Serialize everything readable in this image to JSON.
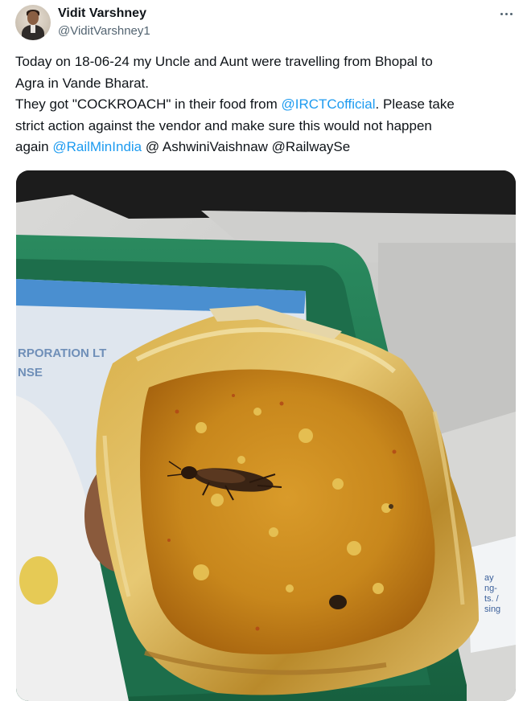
{
  "author": {
    "display_name": "Vidit Varshney",
    "handle": "@ViditVarshney1",
    "avatar_icon": "profile-photo"
  },
  "more_icon": "more-dots-icon",
  "tweet": {
    "line1": "Today on 18-06-24 my Uncle and Aunt were travelling from Bhopal to",
    "line2": "Agra in Vande Bharat.",
    "line3_pre": "They got \"COCKROACH\" in their food from ",
    "mention_irctc": "@IRCTCofficial",
    "line3_post": ". Please take",
    "line4": "strict action against the vendor and make sure this would not happen",
    "line5_pre": "again ",
    "mention_railmin": "@RailMinIndia",
    "line5_post": " @ AshwiniVaishnaw @RailwaySe"
  },
  "media": {
    "tray_text_line1": "RPORATION LT",
    "tray_text_line2": "NSE",
    "packet_text": [
      "ay",
      "ng-",
      "ts. /",
      "sing"
    ]
  },
  "colors": {
    "mention": "#1d9bf0",
    "text": "#0f1419",
    "secondary": "#536471",
    "tray_green": "#1f7a53",
    "dal": "#c98a1f"
  }
}
